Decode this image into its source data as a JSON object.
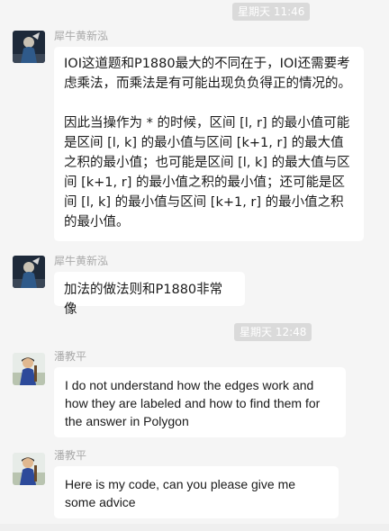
{
  "time_divider_1": "星期天 11:46",
  "time_divider_2": "星期天 12:48",
  "messages": [
    {
      "sender": "犀牛黄新泓",
      "paragraphs": [
        "IOI这道题和P1880最大的不同在于，IOI还需要考虑乘法，而乘法是有可能出现负负得正的情况的。",
        "因此当操作为 * 的时候，区间 [l, r] 的最小值可能是区间 [l, k] 的最小值与区间 [k+1, r] 的最大值之积的最小值；也可能是区间 [l, k] 的最大值与区间 [k+1, r] 的最小值之积的最小值；还可能是区间 [l, k] 的最小值与区间 [k+1, r] 的最小值之积的最小值。"
      ]
    },
    {
      "sender": "犀牛黄新泓",
      "text": "加法的做法则和P1880非常像"
    },
    {
      "sender": "潘教平",
      "text": "I do not understand how the edges work and how they are labeled and how to find them for the answer in Polygon"
    },
    {
      "sender": "潘教平",
      "text": "Here is my code, can you please give me some advice"
    }
  ],
  "colors": {
    "background": "#f5f5f5",
    "bubble": "#ffffff",
    "time_pill": "#dadada",
    "sender_name": "#a9a9a9"
  },
  "icons": {
    "avatar_1": "avatar-figure-dark",
    "avatar_2": "avatar-child-photo"
  }
}
